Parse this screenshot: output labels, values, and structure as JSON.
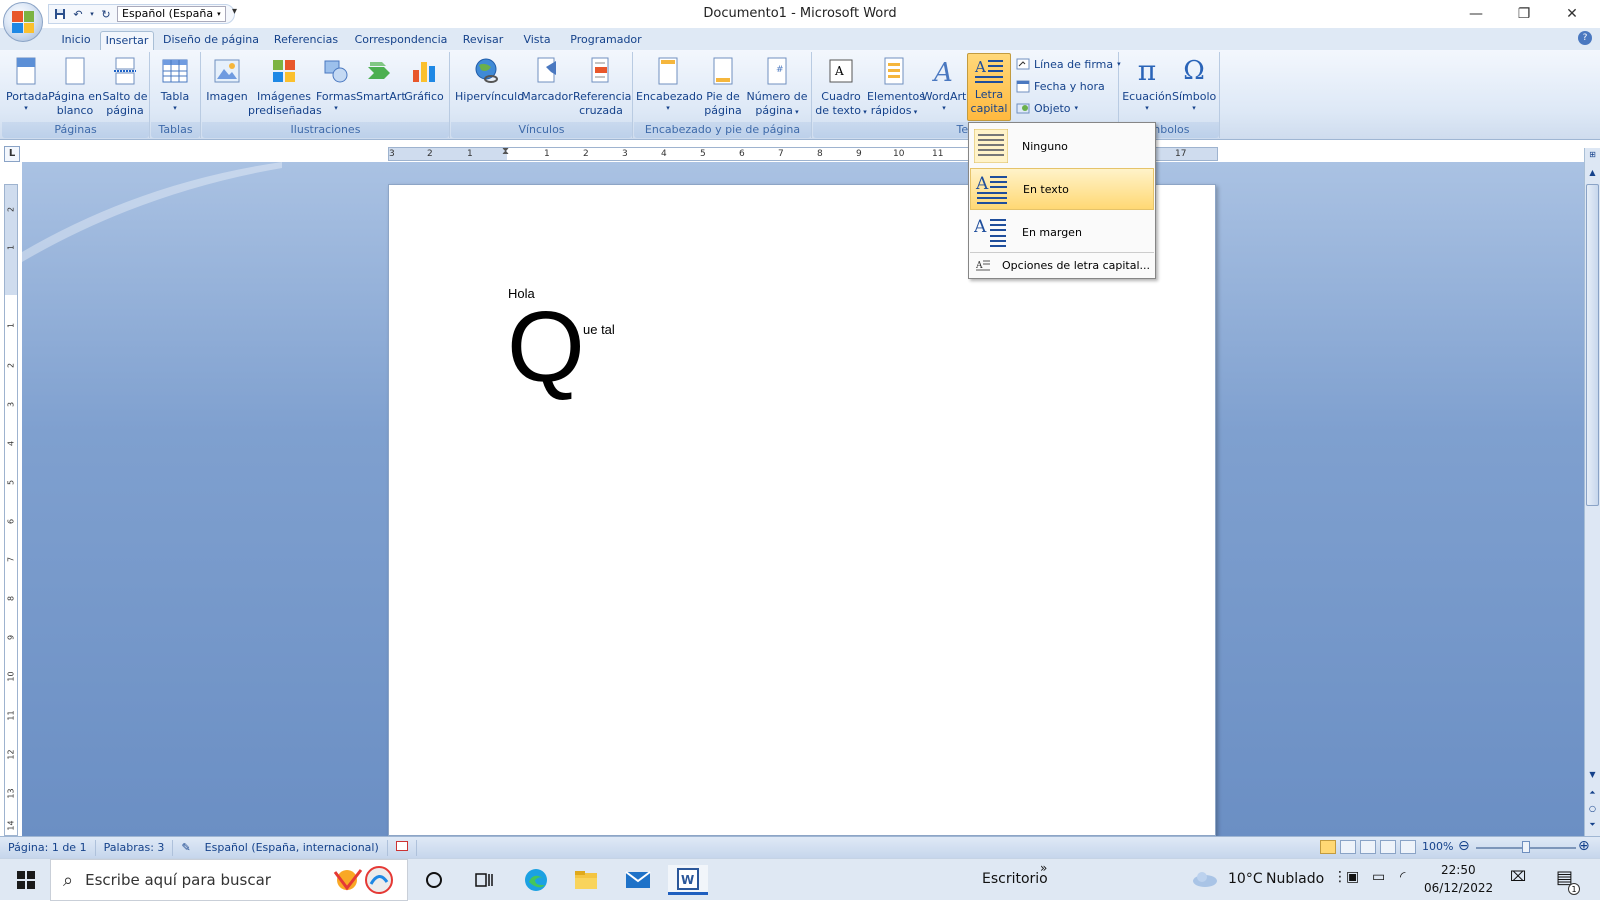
{
  "title": "Documento1 - Microsoft Word",
  "qat": {
    "language": "Español (España"
  },
  "tabs": [
    "Inicio",
    "Insertar",
    "Diseño de página",
    "Referencias",
    "Correspondencia",
    "Revisar",
    "Vista",
    "Programador"
  ],
  "ribbon": {
    "groups": {
      "paginas": "Páginas",
      "tablas": "Tablas",
      "ilustraciones": "Ilustraciones",
      "vinculos": "Vínculos",
      "encabezado": "Encabezado y pie de página",
      "texto": "Tex",
      "simbolos": "mbolos"
    },
    "buttons": {
      "portada": "Portada",
      "pagina_blanco_1": "Página en",
      "pagina_blanco_2": "blanco",
      "salto_1": "Salto de",
      "salto_2": "página",
      "tabla": "Tabla",
      "imagen": "Imagen",
      "imagenes_1": "Imágenes",
      "imagenes_2": "prediseñadas",
      "formas": "Formas",
      "smartart": "SmartArt",
      "grafico": "Gráfico",
      "hipervinculo": "Hipervínculo",
      "marcador": "Marcador",
      "referencia_1": "Referencia",
      "referencia_2": "cruzada",
      "encabezado": "Encabezado",
      "pie_1": "Pie de",
      "pie_2": "página",
      "numero_1": "Número de",
      "numero_2": "página",
      "cuadro_1": "Cuadro",
      "cuadro_2": "de texto",
      "elementos_1": "Elementos",
      "elementos_2": "rápidos",
      "wordart": "WordArt",
      "letra_1": "Letra",
      "letra_2": "capital",
      "linea_firma": "Línea de firma",
      "fecha_hora": "Fecha y hora",
      "objeto": "Objeto",
      "ecuacion": "Ecuación",
      "simbolo": "Símbolo"
    }
  },
  "dropdown": {
    "items": [
      "Ninguno",
      "En texto",
      "En margen"
    ],
    "options": "Opciones de letra capital..."
  },
  "ruler": {
    "h_ticks": [
      "3",
      "2",
      "1",
      "1",
      "2",
      "3",
      "4",
      "5",
      "6",
      "7",
      "8",
      "9",
      "10",
      "11",
      "17"
    ],
    "v_ticks": [
      "2",
      "1",
      "1",
      "2",
      "3",
      "4",
      "5",
      "6",
      "7",
      "8",
      "9",
      "10",
      "11",
      "12",
      "13",
      "14"
    ],
    "corner": "L"
  },
  "document": {
    "line1": "Hola",
    "drop_cap": "Q",
    "rest": "ue tal"
  },
  "status": {
    "page": "Página: 1 de 1",
    "words": "Palabras: 3",
    "language": "Español (España, internacional)",
    "zoom": "100%"
  },
  "taskbar": {
    "search_placeholder": "Escribe aquí para buscar",
    "desktop": "Escritorio",
    "temperature": "10°C",
    "weather": "Nublado",
    "time": "22:50",
    "date": "06/12/2022",
    "notifications": "1"
  },
  "colors": {
    "accent": "#15428b",
    "ribbon": "#dde8f6",
    "highlight": "#ffd874",
    "workspace": "#7fa0cf"
  }
}
